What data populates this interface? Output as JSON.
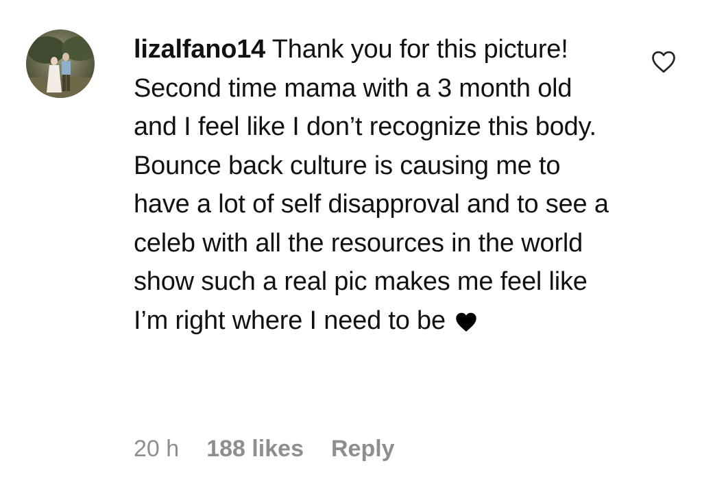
{
  "comment": {
    "username": "lizalfano14",
    "text": "Thank you for this picture! Second time mama with a 3 month old and I feel like I don’t recognize this body. Bounce back culture is causing me to have a lot of self disapproval and to see a celeb with all the resources in the world show such a real pic makes me feel like I’m right where I need to be",
    "emoji": "black-heart-icon",
    "time": "20 h",
    "likes": "188 likes",
    "reply_label": "Reply"
  },
  "icons": {
    "like": "heart-outline-icon",
    "avatar": "avatar"
  },
  "colors": {
    "text": "#111111",
    "meta": "#8e8e8e",
    "background": "#ffffff"
  }
}
